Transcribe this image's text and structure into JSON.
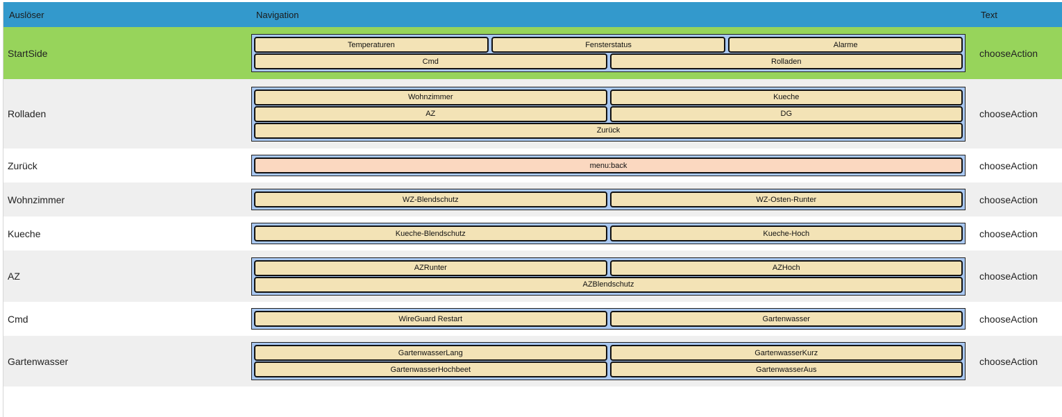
{
  "header": {
    "trigger": "Auslöser",
    "navigation": "Navigation",
    "text": "Text"
  },
  "colors": {
    "header": "#3399cc",
    "active_row": "#97d45b",
    "alt_row": "#efefef",
    "nav_panel": "#a9c8f2",
    "nav_button": "#f3e3b6",
    "back_button": "#fbd8c0"
  },
  "rows": [
    {
      "trigger": "StartSide",
      "text": "chooseAction",
      "nav": [
        [
          "Temperaturen",
          "Fensterstatus",
          "Alarme"
        ],
        [
          "Cmd",
          "Rolladen"
        ]
      ]
    },
    {
      "trigger": "Rolladen",
      "text": "chooseAction",
      "nav": [
        [
          "Wohnzimmer",
          "Kueche"
        ],
        [
          "AZ",
          "DG"
        ],
        [
          "Zurück"
        ]
      ]
    },
    {
      "trigger": "Zurück",
      "text": "chooseAction",
      "nav": [
        [
          "menu:back"
        ]
      ]
    },
    {
      "trigger": "Wohnzimmer",
      "text": "chooseAction",
      "nav": [
        [
          "WZ-Blendschutz",
          "WZ-Osten-Runter"
        ]
      ]
    },
    {
      "trigger": "Kueche",
      "text": "chooseAction",
      "nav": [
        [
          "Kueche-Blendschutz",
          "Kueche-Hoch"
        ]
      ]
    },
    {
      "trigger": "AZ",
      "text": "chooseAction",
      "nav": [
        [
          "AZRunter",
          "AZHoch"
        ],
        [
          "AZBlendschutz"
        ]
      ]
    },
    {
      "trigger": "Cmd",
      "text": "chooseAction",
      "nav": [
        [
          "WireGuard Restart",
          "Gartenwasser"
        ]
      ]
    },
    {
      "trigger": "Gartenwasser",
      "text": "chooseAction",
      "nav": [
        [
          "GartenwasserLang",
          "GartenwasserKurz"
        ],
        [
          "GartenwasserHochbeet",
          "GartenwasserAus"
        ]
      ]
    }
  ]
}
